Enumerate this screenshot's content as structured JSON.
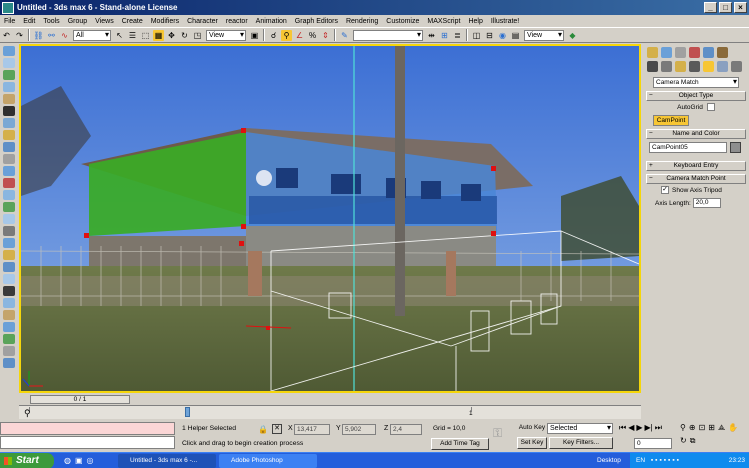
{
  "window": {
    "title": "Untitled - 3ds max 6 - Stand-alone License",
    "controls": [
      "_",
      "□",
      "×"
    ]
  },
  "menu": [
    "File",
    "Edit",
    "Tools",
    "Group",
    "Views",
    "Create",
    "Modifiers",
    "Character",
    "reactor",
    "Animation",
    "Graph Editors",
    "Rendering",
    "Customize",
    "MAXScript",
    "Help",
    "Illustrate!"
  ],
  "toolbar": {
    "selection_filter": "All",
    "ref_coord_1": "View",
    "named_sel": "",
    "ref_coord_2": "View"
  },
  "panel": {
    "dropdown": "Camera Match",
    "object_type": {
      "header": "Object Type",
      "autogrid_label": "AutoGrid",
      "button": "CamPoint"
    },
    "name_color": {
      "header": "Name and Color",
      "name_value": "CamPoint05"
    },
    "keyboard_entry": {
      "header": "Keyboard Entry"
    },
    "camera_match_point": {
      "header": "Camera Match Point",
      "show_axis_label": "Show Axis Tripod",
      "axis_length_label": "Axis Length:",
      "axis_length_value": "20,0"
    }
  },
  "timeline": {
    "frame_display": "0 / 1",
    "track_label": "1"
  },
  "status": {
    "selection": "1 Helper Selected",
    "prompt": "Click and drag to begin creation process",
    "x_label": "X",
    "x_value": "13,417",
    "y_label": "Y",
    "y_value": "5,902",
    "z_label": "Z",
    "z_value": "2,4",
    "grid": "Grid = 10,0",
    "add_time_tag": "Add Time Tag",
    "auto_key": "Auto Key",
    "set_key": "Set Key",
    "key_mode": "Selected",
    "key_filters": "Key Filters...",
    "frame_input": "0"
  },
  "taskbar": {
    "start": "Start",
    "task1": "Untitled - 3ds max 6 -...",
    "task2": "Adobe Photoshop",
    "desktop": "Desktop",
    "lang": "EN",
    "time": "23:23"
  },
  "colors": {
    "viewport_border": "#f5d60a",
    "green_face": "#3aab25",
    "blue_face": "#4a86d6",
    "campoint_button": "#f7c634"
  }
}
